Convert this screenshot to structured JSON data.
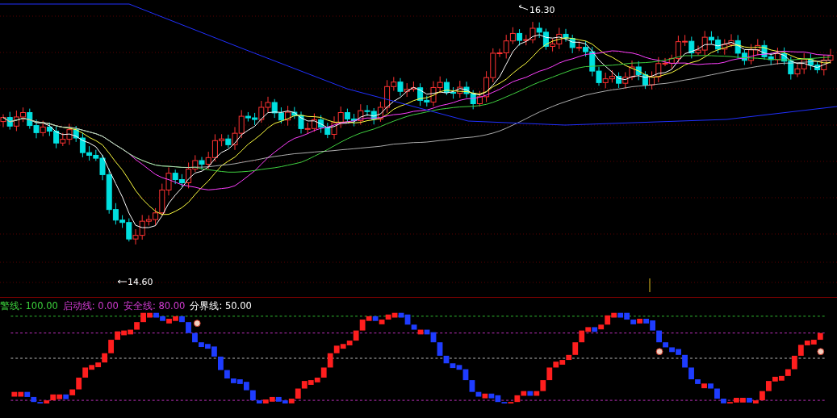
{
  "price_panel": {
    "high_label": "16.30",
    "low_label": "14.60"
  },
  "indicator_panel": {
    "legend": [
      {
        "text": "警线: 100.00",
        "color": "#3cd23c"
      },
      {
        "text": "启动线: 0.00",
        "color": "#d23cd2"
      },
      {
        "text": "安全线: 80.00",
        "color": "#d23cd2"
      },
      {
        "text": "分界线: 50.00",
        "color": "#ffffff"
      }
    ]
  }
}
